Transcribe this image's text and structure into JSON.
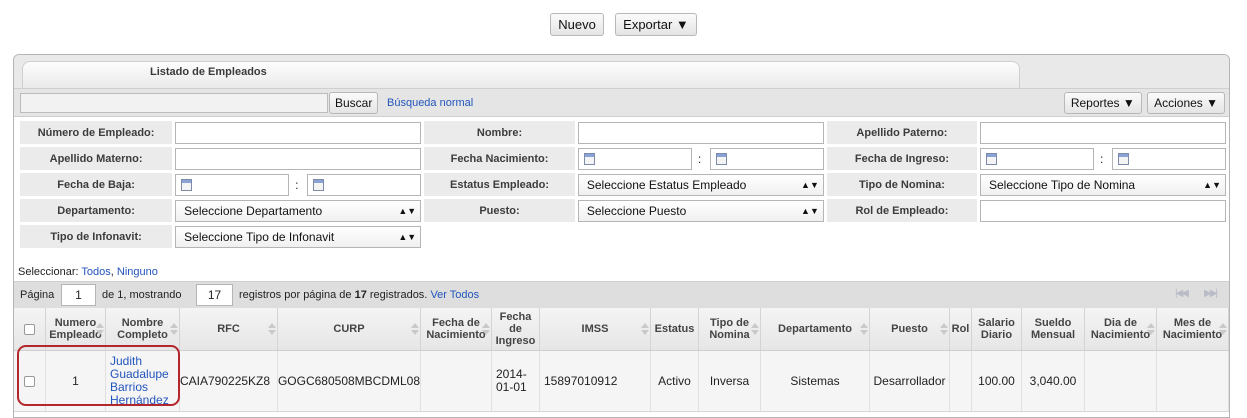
{
  "toolbar": {
    "nuevo": "Nuevo",
    "exportar": "Exportar ▼"
  },
  "panel": {
    "title": "Listado de Empleados"
  },
  "search": {
    "value": "",
    "button": "Buscar",
    "link": "Búsqueda normal",
    "reportes": "Reportes ▼",
    "acciones": "Acciones ▼"
  },
  "filters": {
    "numero_empleado": "Número de Empleado:",
    "nombre": "Nombre:",
    "apellido_paterno": "Apellido Paterno:",
    "apellido_materno": "Apellido Materno:",
    "fecha_nacimiento": "Fecha Nacimiento:",
    "fecha_ingreso": "Fecha de Ingreso:",
    "fecha_baja": "Fecha de Baja:",
    "estatus_empleado": "Estatus Empleado:",
    "estatus_empleado_sel": "Seleccione Estatus Empleado",
    "tipo_nomina": "Tipo de Nomina:",
    "tipo_nomina_sel": "Seleccione Tipo de Nomina",
    "departamento": "Departamento:",
    "departamento_sel": "Seleccione Departamento",
    "puesto": "Puesto:",
    "puesto_sel": "Seleccione Puesto",
    "rol_empleado": "Rol de Empleado:",
    "tipo_infonavit": "Tipo de Infonavit:",
    "tipo_infonavit_sel": "Seleccione Tipo de Infonavit",
    "colon": ":"
  },
  "selection": {
    "label": "Seleccionar:",
    "all": "Todos",
    "sep": ",",
    "none": "Ninguno"
  },
  "pager": {
    "pagina": "Página",
    "page": "1",
    "de": "de 1, mostrando",
    "per_page": "17",
    "registros_pre": "registros por página de",
    "total": "17",
    "registros_post": "registrados.",
    "ver_todos": "Ver Todos",
    "first_icon": "first-page-icon",
    "last_icon": "last-page-icon"
  },
  "columns": {
    "numero": "Numero Empleado",
    "nombre": "Nombre Completo",
    "rfc": "RFC",
    "curp": "CURP",
    "fecha_nac": "Fecha de Nacimiento",
    "fecha_ing": "Fecha de Ingreso",
    "imss": "IMSS",
    "estatus": "Estatus",
    "tipo_nomina": "Tipo de Nomina",
    "departamento": "Departamento",
    "puesto": "Puesto",
    "rol": "Rol",
    "salario": "Salario Diario",
    "sueldo": "Sueldo Mensual",
    "dia_nac": "Dia de Nacimiento",
    "mes_nac": "Mes de Nacimiento"
  },
  "rows": [
    {
      "numero": "1",
      "nombre": "Judith Guadalupe Barrios Hernández",
      "rfc": "CAIA790225KZ8",
      "curp": "GOGC680508MBCDML08",
      "fecha_nac": "",
      "fecha_ing": "2014-01-01",
      "imss": "15897010912",
      "estatus": "Activo",
      "tipo_nomina": "Inversa",
      "departamento": "Sistemas",
      "puesto": "Desarrollador",
      "rol": "",
      "salario": "100.00",
      "sueldo": "3,040.00",
      "dia_nac": "",
      "mes_nac": ""
    }
  ],
  "colors": {
    "link": "#2255bb",
    "highlight": "#b3262b"
  }
}
